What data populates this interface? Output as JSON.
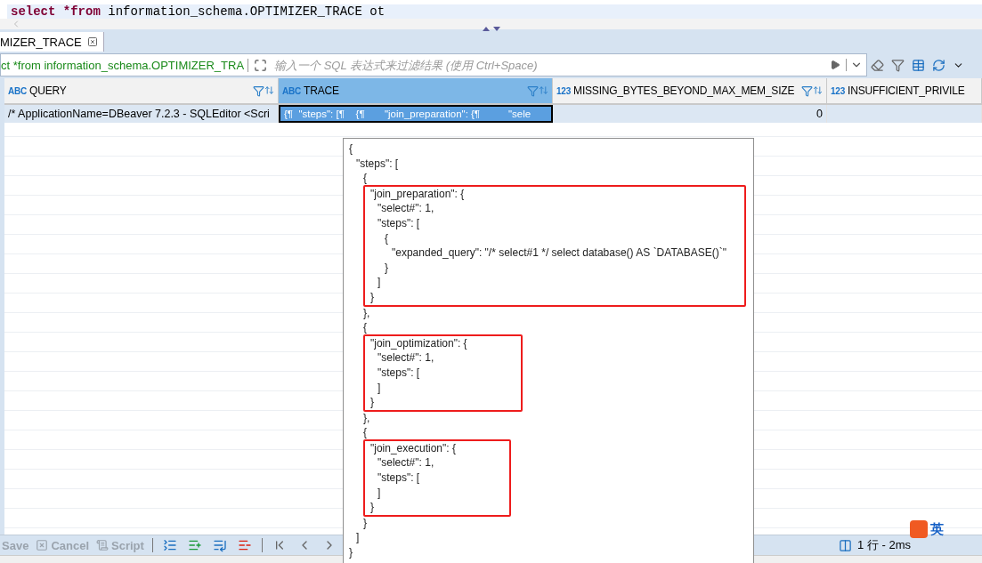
{
  "editor": {
    "tokens": [
      {
        "text": "select ",
        "kind": "keyword"
      },
      {
        "text": "*from",
        "kind": "keyword"
      },
      {
        "text": " information_schema.OPTIMIZER_TRACE ot",
        "kind": "plain"
      }
    ]
  },
  "result_tab": {
    "label": "MIZER_TRACE",
    "selected": true
  },
  "filter": {
    "query": "ct *from information_schema.OPTIMIZER_TRA",
    "placeholder": "输入一个 SQL 表达式来过滤结果 (使用 Ctrl+Space)"
  },
  "table": {
    "columns": [
      {
        "type_label": "ABC",
        "kind": "text",
        "name": "QUERY",
        "selected": false
      },
      {
        "type_label": "ABC",
        "kind": "text",
        "name": "TRACE",
        "selected": true
      },
      {
        "type_label": "123",
        "kind": "number",
        "name": "MISSING_BYTES_BEYOND_MAX_MEM_SIZE",
        "selected": false
      },
      {
        "type_label": "123",
        "kind": "number",
        "name": "INSUFFICIENT_PRIVILE",
        "selected": false
      }
    ],
    "rows": [
      {
        "selected": true,
        "cells": [
          {
            "text": "/* ApplicationName=DBeaver 7.2.3 - SQLEditor <Scri",
            "selected": false
          },
          {
            "text": "{¶  \"steps\": [¶    {¶       \"join_preparation\": {¶          \"sele",
            "selected": true
          },
          {
            "text": "0",
            "selected": false
          },
          {
            "selected": false
          }
        ]
      }
    ]
  },
  "bottom_toolbar": {
    "buttons": [
      {
        "label": "Save",
        "kind": "save",
        "disabled": true
      },
      {
        "label": "Cancel",
        "kind": "cancel",
        "disabled": true
      },
      {
        "label": "Script",
        "kind": "script",
        "disabled": true
      }
    ]
  },
  "status": {
    "text": "1 行 - 2ms"
  },
  "ime": {
    "label": "英"
  },
  "value_popup": {
    "lines": [
      {
        "kind": "line",
        "text": "{"
      },
      {
        "kind": "line",
        "text": "  \"steps\": ["
      },
      {
        "kind": "line",
        "text": "    {"
      },
      {
        "kind": "highlight",
        "lines": [
          "      \"join_preparation\": {",
          "        \"select#\": 1,",
          "        \"steps\": [",
          "          {",
          "            \"expanded_query\": \"/* select#1 */ select database() AS `DATABASE()`\"",
          "          }",
          "        ]",
          "      }"
        ]
      },
      {
        "kind": "line",
        "text": "    },"
      },
      {
        "kind": "line",
        "text": "    {"
      },
      {
        "kind": "highlight",
        "lines": [
          "      \"join_optimization\": {",
          "        \"select#\": 1,",
          "        \"steps\": [",
          "        ]",
          "      }"
        ]
      },
      {
        "kind": "line",
        "text": "    },"
      },
      {
        "kind": "line",
        "text": "    {"
      },
      {
        "kind": "highlight",
        "lines": [
          "      \"join_execution\": {",
          "        \"select#\": 1,",
          "        \"steps\": [",
          "        ]",
          "      }"
        ]
      },
      {
        "kind": "line",
        "text": "    }"
      },
      {
        "kind": "line",
        "text": "  ]"
      },
      {
        "kind": "line",
        "text": "}"
      }
    ]
  }
}
